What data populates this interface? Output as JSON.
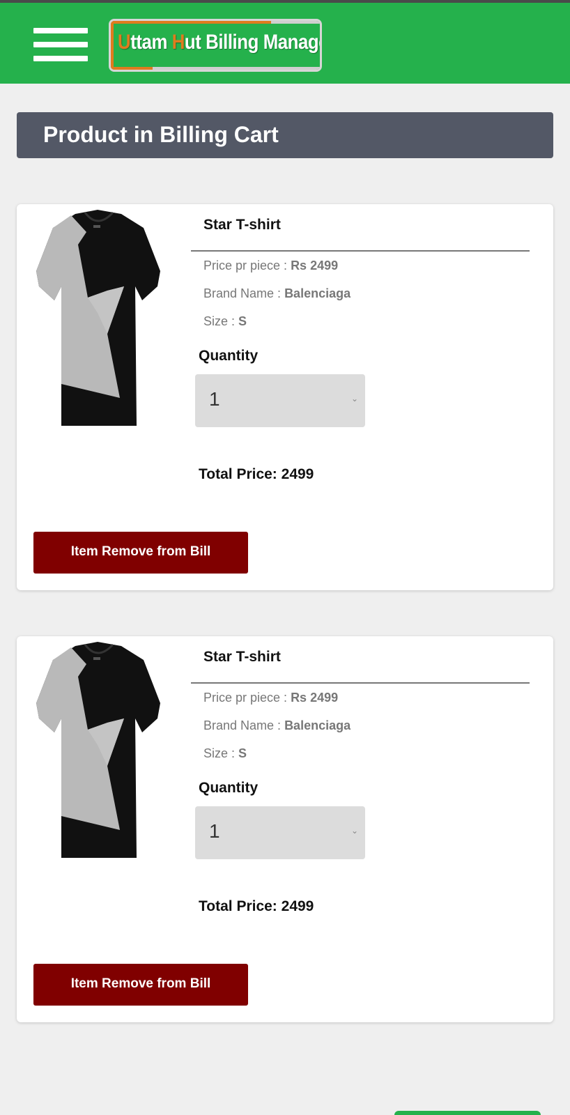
{
  "header": {
    "logo_part1_initial": "U",
    "logo_part1_rest": "ttam ",
    "logo_part2_initial": "H",
    "logo_part2_rest": "ut Billing Manager",
    "brand_color": "#25b14c",
    "accent_color": "#e07b1e"
  },
  "cart": {
    "title": "Product in Billing Cart",
    "items": [
      {
        "name": "Star T-shirt",
        "price_label": "Price pr piece : ",
        "price_value": "Rs 2499",
        "brand_label": "Brand Name : ",
        "brand_value": "Balenciaga",
        "size_label": "Size : ",
        "size_value": "S",
        "quantity_label": "Quantity",
        "quantity_value": "1",
        "total_label": "Total Price: 2499",
        "remove_label": "Item Remove from Bill"
      },
      {
        "name": "Star T-shirt",
        "price_label": "Price pr piece : ",
        "price_value": "Rs 2499",
        "brand_label": "Brand Name : ",
        "brand_value": "Balenciaga",
        "size_label": "Size : ",
        "size_value": "S",
        "quantity_label": "Quantity",
        "quantity_value": "1",
        "total_label": "Total Price: 2499",
        "remove_label": "Item Remove from Bill"
      }
    ]
  },
  "colors": {
    "remove_button": "#800000",
    "cart_header_bg": "#535866"
  },
  "icons": [
    "menu-icon",
    "chevron-down-icon"
  ]
}
